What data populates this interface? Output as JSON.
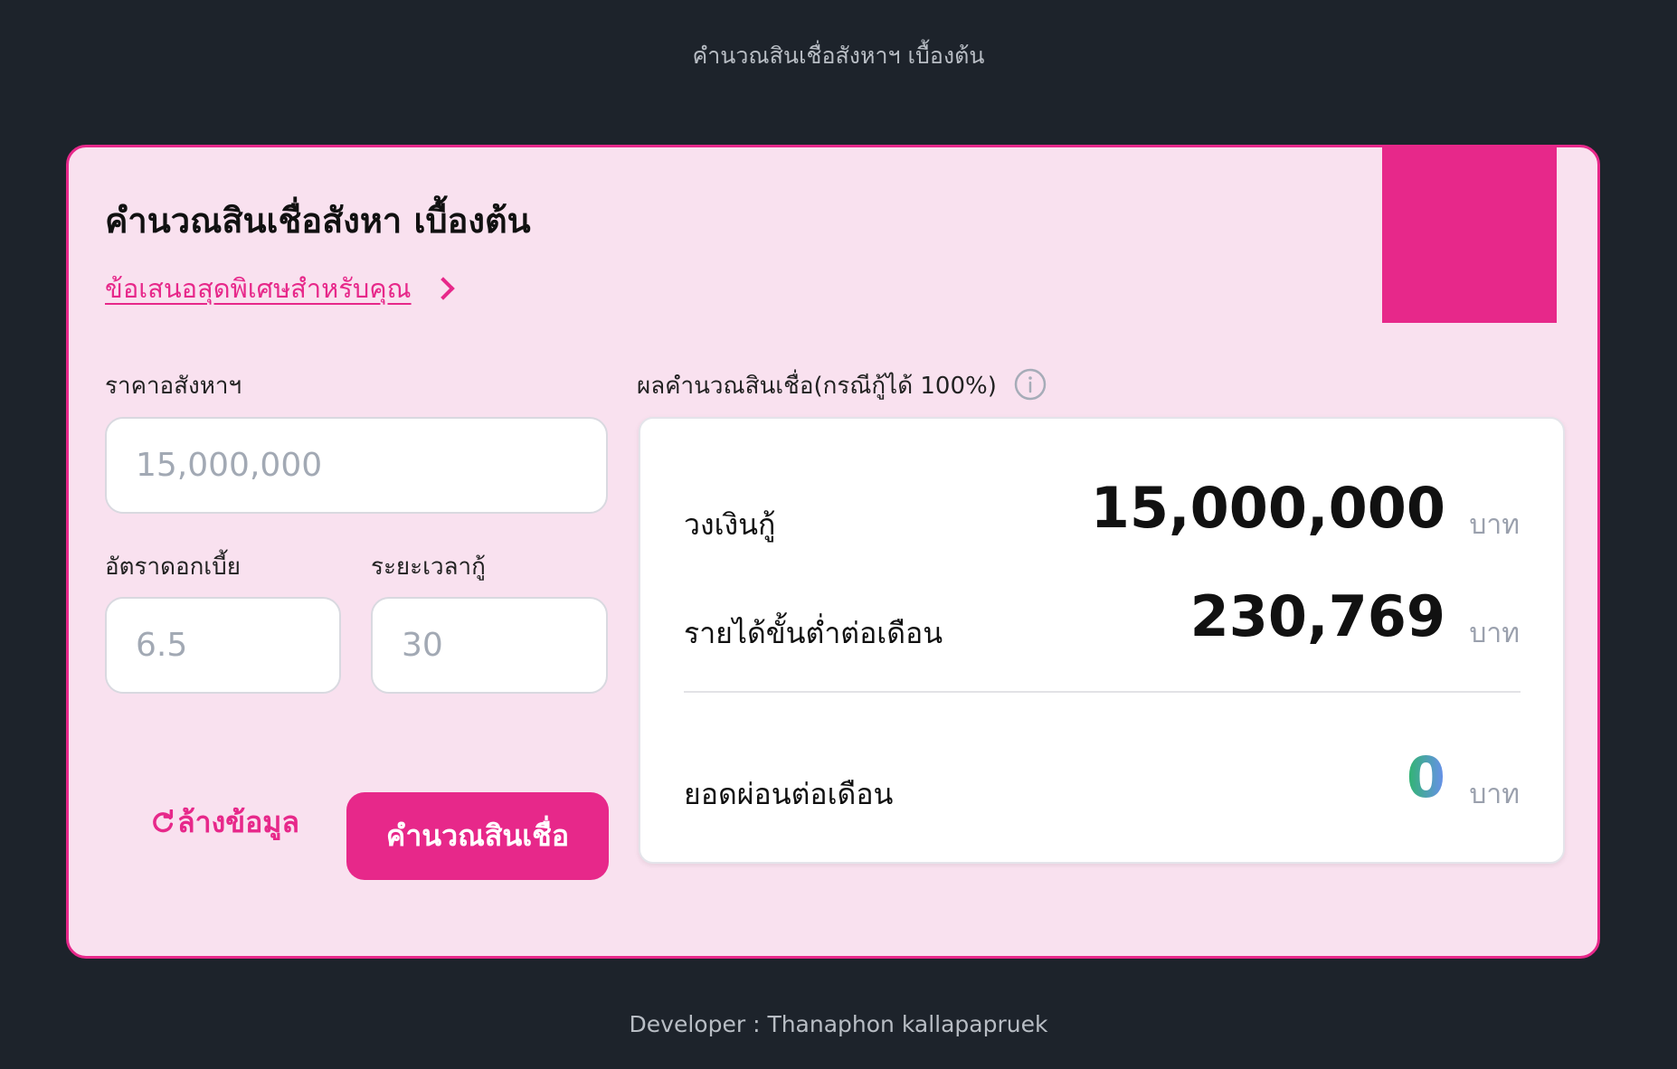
{
  "page": {
    "heading": "คำนวณสินเชื่อสังหาฯ เบื้องต้น",
    "footer": "Developer : Thanaphon kallapapruek"
  },
  "card": {
    "title": "คำนวณสินเชื่อสังหา เบื้องต้น",
    "promo_link": "ข้อเสนอสุดพิเศษสำหรับคุณ",
    "accent_color": "#e7288a"
  },
  "form": {
    "price_label": "ราคาอสังหาฯ",
    "price_placeholder": "15,000,000",
    "rate_label": "อัตราดอกเบี้ย",
    "rate_placeholder": "6.5",
    "term_label": "ระยะเวลากู้",
    "term_placeholder": "30",
    "reset_label": "ล้างข้อมูล",
    "calculate_label": "คำนวณสินเชื่อ"
  },
  "result": {
    "header": "ผลคำนวณสินเชื่อ(กรณีกู้ได้ 100%)",
    "loan_label": "วงเงินกู้",
    "loan_value": "15,000,000",
    "income_label": "รายได้ขั้นต่ำต่อเดือน",
    "income_value": "230,769",
    "payment_label": "ยอดผ่อนต่อเดือน",
    "payment_value": "0",
    "unit": "บาท"
  }
}
